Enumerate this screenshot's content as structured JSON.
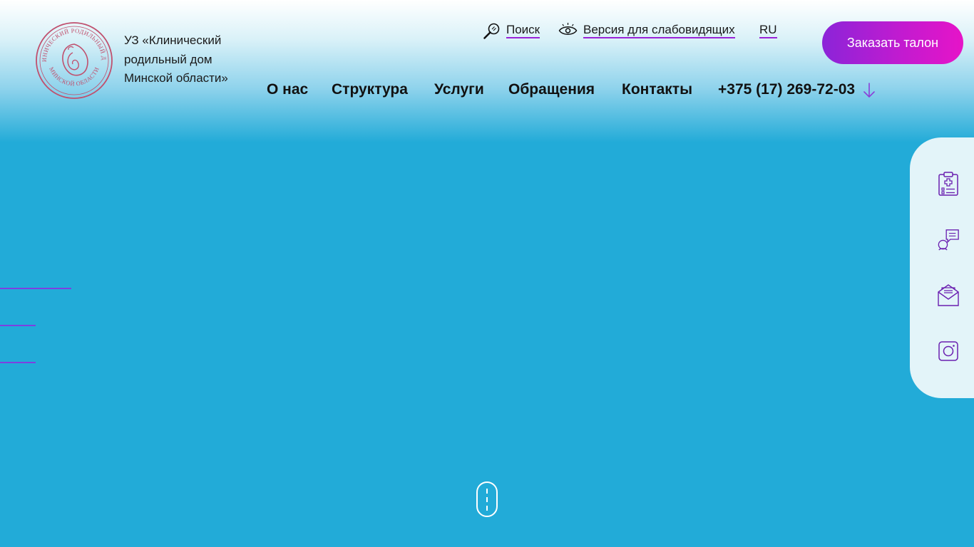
{
  "header": {
    "org_name_lines": [
      "УЗ «Клинический",
      "родильный дом",
      "Минской области»"
    ],
    "logo": {
      "text_top": "КЛИНИЧЕСКИЙ РОДИЛЬНЫЙ ДОМ",
      "text_bottom": "МИНСКОЙ ОБЛАСТИ",
      "color": "#c0506e"
    },
    "utility": {
      "search_label": "Поиск",
      "search_icon": "search-icon",
      "accessibility_label": "Версия для слабовидящих",
      "accessibility_icon": "eye-icon",
      "language_label": "RU"
    },
    "cta_label": "Заказать талон",
    "nav": [
      "О нас",
      "Структура",
      "Услуги",
      "Обращения",
      "Контакты"
    ],
    "phone": "+375 (17) 269-72-03",
    "phone_icon": "arrow-down-icon"
  },
  "side_panel": {
    "icons": [
      "clipboard-medical-icon",
      "chat-person-icon",
      "mail-icon",
      "instagram-icon"
    ]
  },
  "colors": {
    "background": "#22abd8",
    "accent": "#9a22d8",
    "cta_gradient_start": "#8b24d8",
    "cta_gradient_end": "#e614c8",
    "side_panel": "#e3f4f9",
    "icon": "#6a1fb0"
  },
  "scroll_indicator_icon": "scroll-mouse-icon"
}
